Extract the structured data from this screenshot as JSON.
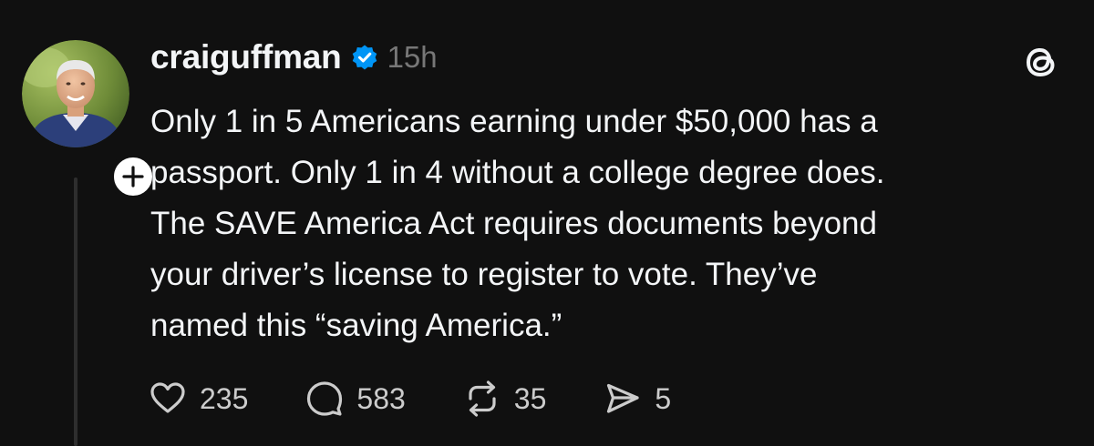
{
  "post": {
    "username": "craiguffman",
    "timestamp": "15h",
    "verified_color": "#0095f6",
    "text_lines": [
      "Only 1 in 5 Americans earning under $50,000 has a",
      "passport. Only 1 in 4 without a college degree does.",
      "The SAVE America Act requires documents beyond",
      "your driver’s license to register to vote. They’ve",
      "named this “saving America.”"
    ],
    "actions": {
      "likes": "235",
      "replies": "583",
      "reposts": "35",
      "shares": "5"
    },
    "icons": {
      "like": "heart-icon",
      "reply": "speech-bubble-icon",
      "repost": "repost-arrows-icon",
      "share": "send-icon",
      "follow": "plus-icon",
      "verified": "verified-check-badge-icon",
      "app": "threads-logo-icon"
    }
  }
}
